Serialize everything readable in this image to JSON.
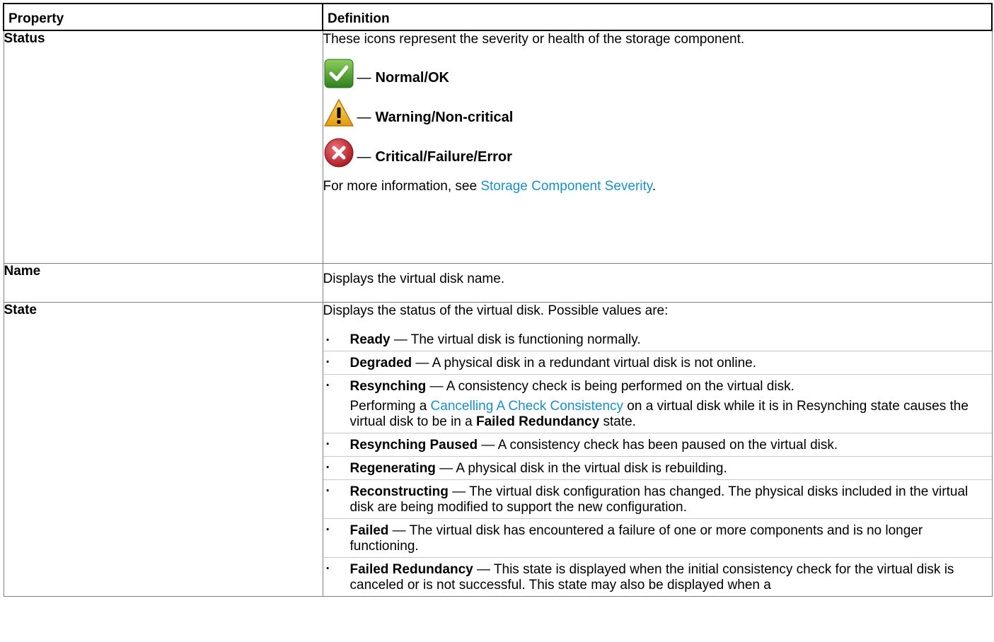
{
  "table": {
    "header": {
      "property": "Property",
      "definition": "Definition"
    },
    "status": {
      "property": "Status",
      "intro": "These icons represent the severity or health of the storage component.",
      "severities": [
        {
          "icon": "check-icon",
          "dash": "—",
          "label": "Normal/OK",
          "color": "#3f9a2e"
        },
        {
          "icon": "warning-icon",
          "dash": "—",
          "label": "Warning/Non-critical",
          "color": "#f1b21b"
        },
        {
          "icon": "error-icon",
          "dash": "—",
          "label": "Critical/Failure/Error",
          "color": "#c5202a"
        }
      ],
      "more_prefix": "For more information, see ",
      "more_link": "Storage Component Severity",
      "more_suffix": "."
    },
    "name": {
      "property": "Name",
      "definition": "Displays the virtual disk name."
    },
    "state": {
      "property": "State",
      "intro": "Displays the status of the virtual disk. Possible values are:",
      "items": [
        {
          "term": "Ready",
          "desc": " — The virtual disk is functioning normally."
        },
        {
          "term": "Degraded",
          "desc": " — A physical disk in a redundant virtual disk is not online."
        },
        {
          "term": "Resynching",
          "desc": " — A consistency check is being performed on the virtual disk.",
          "note_prefix": "Performing a ",
          "note_link": "Cancelling A Check Consistency",
          "note_mid": " on a virtual disk while it is in Resynching state causes the virtual disk to be in a ",
          "note_bold": "Failed Redundancy",
          "note_suffix": " state."
        },
        {
          "term": "Resynching Paused",
          "desc": " — A consistency check has been paused on the virtual disk."
        },
        {
          "term": "Regenerating",
          "desc": " — A physical disk in the virtual disk is rebuilding."
        },
        {
          "term": "Reconstructing",
          "desc": " — The virtual disk configuration has changed. The physical disks included in the virtual disk are being modified to support the new configuration."
        },
        {
          "term": "Failed",
          "desc": " — The virtual disk has encountered a failure of one or more components and is no longer functioning."
        },
        {
          "term": "Failed Redundancy",
          "desc": " — This state is displayed when the initial consistency check for the virtual disk is canceled or is not successful. This state may also be displayed when a"
        }
      ]
    }
  },
  "colors": {
    "link": "#1a8fc7",
    "border": "#000000"
  }
}
